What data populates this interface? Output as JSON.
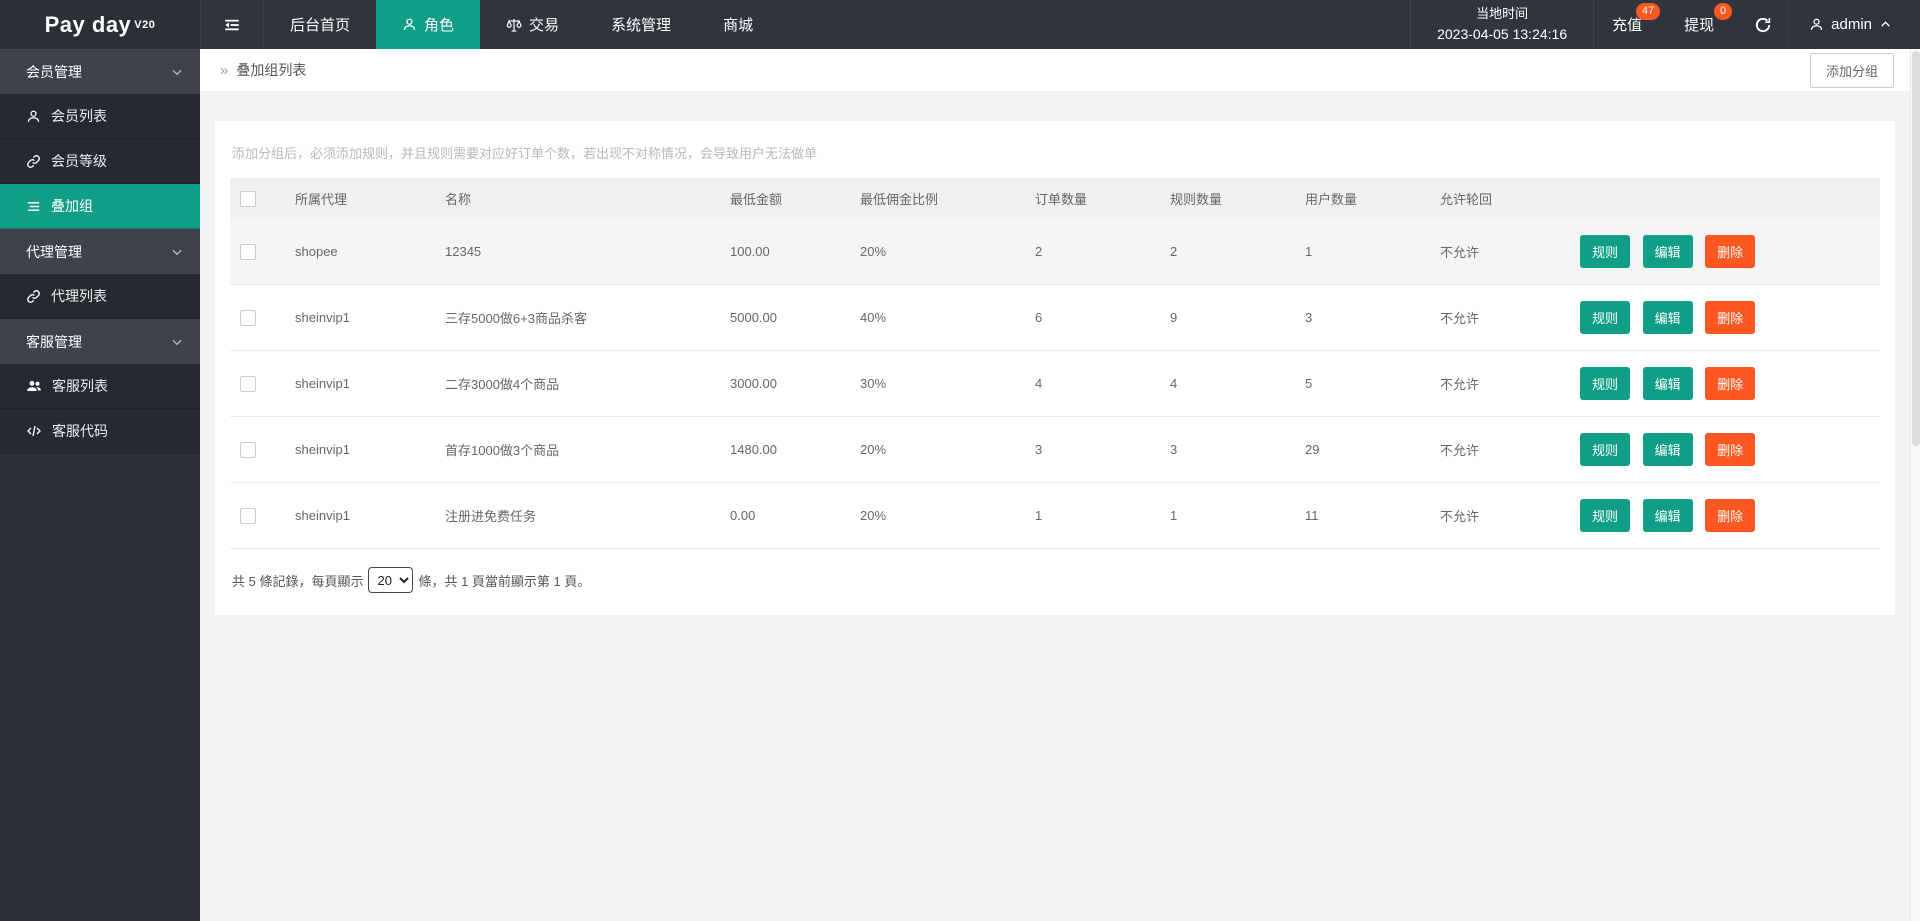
{
  "colors": {
    "accent": "#119e86",
    "danger": "#ff5722",
    "badge": "#ff5722",
    "topbar_bg": "#30343c"
  },
  "topbar": {
    "logo": "Pay day",
    "logo_version": "V20",
    "tabs": [
      {
        "label": "后台首页",
        "icon": "none",
        "active": false
      },
      {
        "label": "角色",
        "icon": "user-icon",
        "active": true
      },
      {
        "label": "交易",
        "icon": "scales-icon",
        "active": false
      },
      {
        "label": "系统管理",
        "icon": "none",
        "active": false
      },
      {
        "label": "商城",
        "icon": "none",
        "active": false
      }
    ],
    "local_time_label": "当地时间",
    "local_time_value": "2023-04-05 13:24:16",
    "recharge_label": "充值",
    "recharge_badge": "47",
    "withdraw_label": "提现",
    "withdraw_badge": "0",
    "username": "admin"
  },
  "sidebar": {
    "sections": [
      {
        "label": "会员管理",
        "items": [
          {
            "label": "会员列表",
            "icon": "user-icon",
            "active": false
          },
          {
            "label": "会员等级",
            "icon": "link-icon",
            "active": false
          },
          {
            "label": "叠加组",
            "icon": "list-icon",
            "active": true
          }
        ]
      },
      {
        "label": "代理管理",
        "items": [
          {
            "label": "代理列表",
            "icon": "link-icon",
            "active": false
          }
        ]
      },
      {
        "label": "客服管理",
        "items": [
          {
            "label": "客服列表",
            "icon": "users-icon",
            "active": false
          },
          {
            "label": "客服代码",
            "icon": "code-icon",
            "active": false
          }
        ]
      }
    ]
  },
  "breadcrumb": {
    "glyph": "»",
    "title": "叠加组列表",
    "add_button": "添加分组"
  },
  "main": {
    "hint": "添加分组后，必须添加规则，并且规则需要对应好订单个数，若出现不对称情况，会导致用户无法做单",
    "table": {
      "headers": [
        "所属代理",
        "名称",
        "最低金额",
        "最低佣金比例",
        "订单数量",
        "规则数量",
        "用户数量",
        "允许轮回"
      ],
      "actions": {
        "rule": "规则",
        "edit": "编辑",
        "delete": "删除"
      },
      "rows": [
        {
          "agent": "shopee",
          "name": "12345",
          "min_amount": "100.00",
          "min_commission": "20%",
          "orders": "2",
          "rules": "2",
          "users": "1",
          "loop": "不允许"
        },
        {
          "agent": "sheinvip1",
          "name": "三存5000做6+3商品杀客",
          "min_amount": "5000.00",
          "min_commission": "40%",
          "orders": "6",
          "rules": "9",
          "users": "3",
          "loop": "不允许"
        },
        {
          "agent": "sheinvip1",
          "name": "二存3000做4个商品",
          "min_amount": "3000.00",
          "min_commission": "30%",
          "orders": "4",
          "rules": "4",
          "users": "5",
          "loop": "不允许"
        },
        {
          "agent": "sheinvip1",
          "name": "首存1000做3个商品",
          "min_amount": "1480.00",
          "min_commission": "20%",
          "orders": "3",
          "rules": "3",
          "users": "29",
          "loop": "不允许"
        },
        {
          "agent": "sheinvip1",
          "name": "注册进免费任务",
          "min_amount": "0.00",
          "min_commission": "20%",
          "orders": "1",
          "rules": "1",
          "users": "11",
          "loop": "不允许"
        }
      ]
    },
    "pagination": {
      "prefix": "共 5 條記錄，每頁顯示",
      "page_size": "20",
      "suffix": "條，共 1 頁當前顯示第 1 頁。"
    }
  }
}
